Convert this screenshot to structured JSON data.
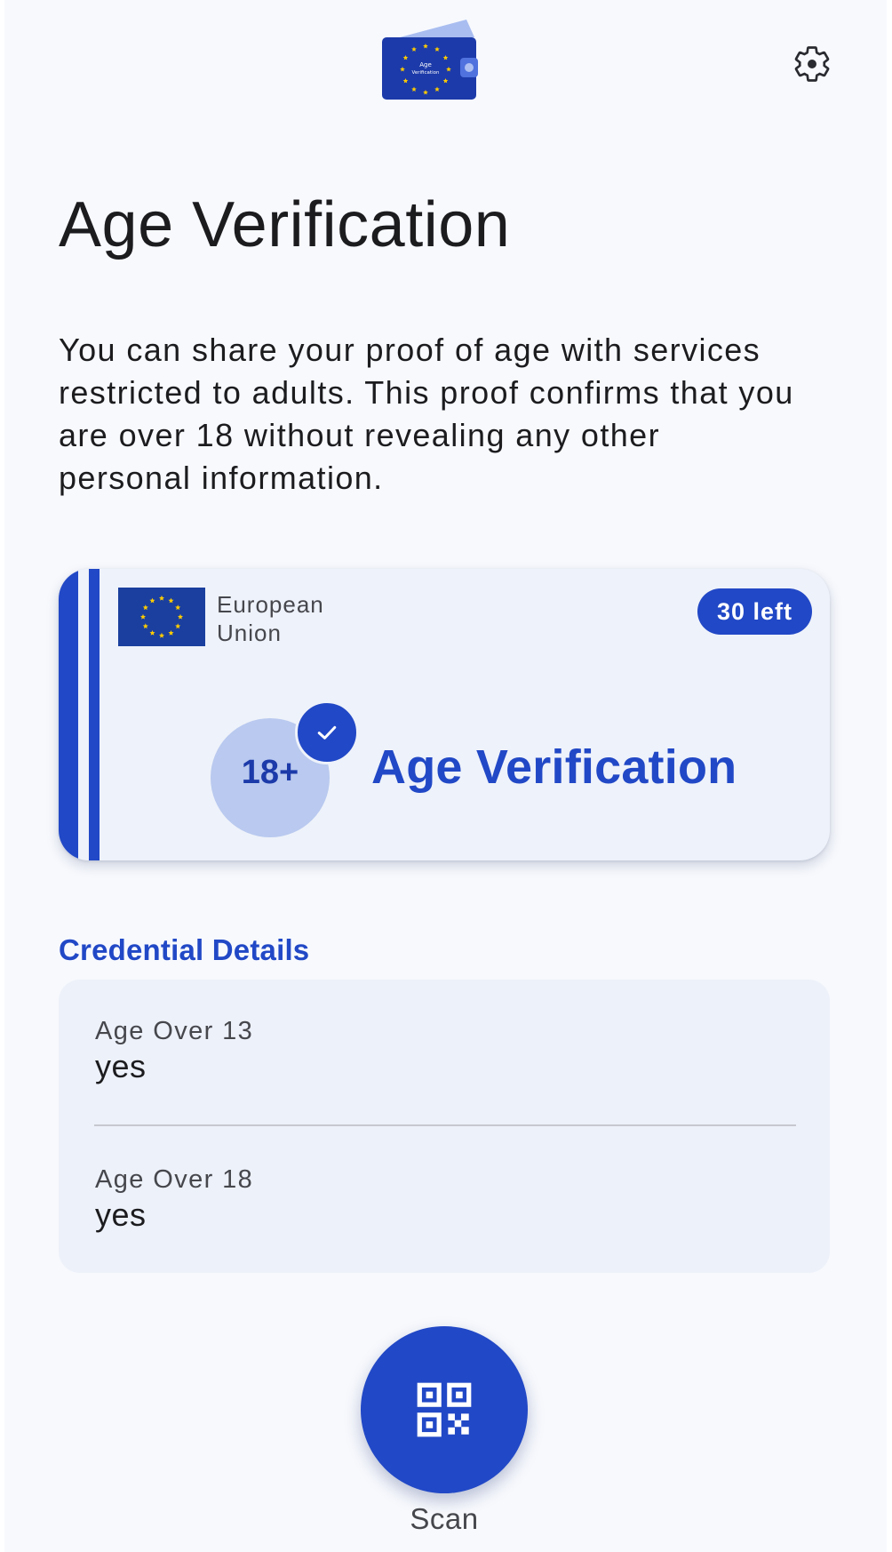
{
  "header": {
    "logo": {
      "icon": "wallet-logo-icon",
      "text_line1": "Age",
      "text_line2": "Verification"
    },
    "settings_icon": "gear-icon"
  },
  "page": {
    "title": "Age Verification",
    "intro": "You can share your proof of age with services restricted to adults. This proof confirms that you are over 18 without revealing any other personal information."
  },
  "credential_card": {
    "issuer": "European Union",
    "flag_icon": "eu-flag-icon",
    "remaining": "30 left",
    "badge_text": "18+",
    "verified_icon": "check-icon",
    "title": "Age Verification"
  },
  "details": {
    "section_title": "Credential Details",
    "rows": [
      {
        "label": "Age Over 13",
        "value": "yes"
      },
      {
        "label": "Age Over 18",
        "value": "yes"
      }
    ]
  },
  "scan": {
    "label": "Scan",
    "icon": "qr-code-icon"
  },
  "colors": {
    "primary": "#2148c6",
    "background": "#f7f9fd",
    "card": "#eef2fa",
    "badge_circle": "#b9c9ef",
    "eu_yellow": "#ffcc00",
    "eu_blue": "#1a3f9e"
  }
}
